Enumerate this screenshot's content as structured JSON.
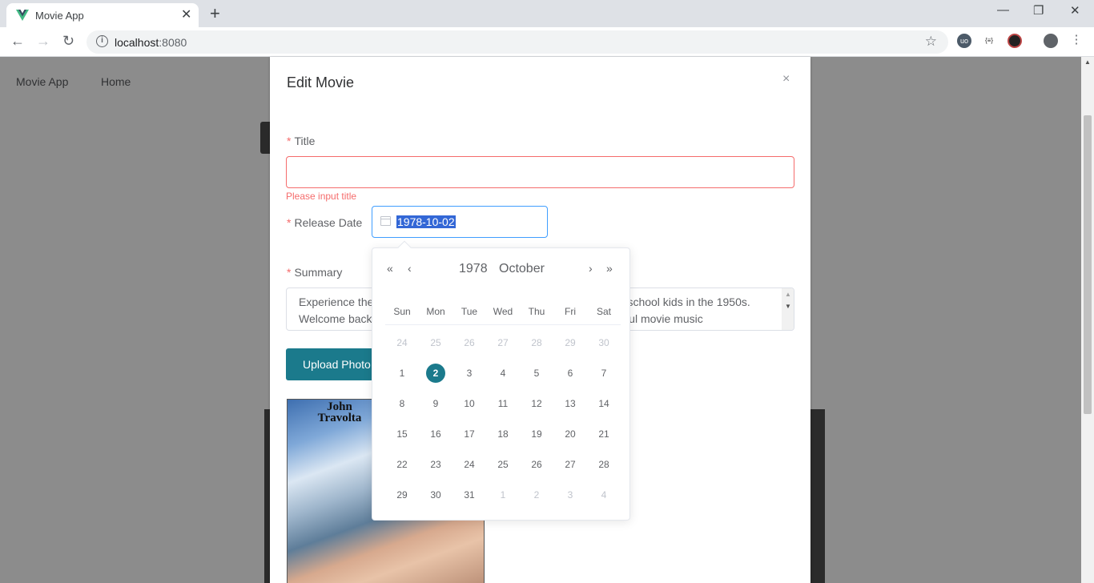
{
  "browser": {
    "tab_title": "Movie App",
    "url_host": "localhost",
    "url_port": ":8080",
    "tab_close": "✕",
    "new_tab": "+",
    "minimize": "—",
    "restore": "❐",
    "close": "✕",
    "back": "←",
    "forward": "→",
    "reload": "↻",
    "star": "☆",
    "accent": "#1b7a8c"
  },
  "nav": {
    "brand": "Movie App",
    "home": "Home"
  },
  "dialog": {
    "title": "Edit Movie",
    "close": "×",
    "title_label": "Title",
    "title_value": "",
    "title_error": "Please input title",
    "release_label": "Release Date",
    "release_value": "1978-10-02",
    "summary_label": "Summary",
    "summary_text": "Experience the fun and frolic of Rydell High School's class of high school kids in the 1950s. Welcome back to the musical phenomenon with the most successful movie music",
    "required_mark": "*",
    "upload_button": "Upload Photo",
    "poster_text": "John Travolta"
  },
  "datepicker": {
    "year": "1978",
    "month": "October",
    "prev_year": "«",
    "prev_month": "‹",
    "next_month": "›",
    "next_year": "»",
    "weekdays": [
      "Sun",
      "Mon",
      "Tue",
      "Wed",
      "Thu",
      "Fri",
      "Sat"
    ],
    "weeks": [
      [
        "24",
        "25",
        "26",
        "27",
        "28",
        "29",
        "30"
      ],
      [
        "1",
        "2",
        "3",
        "4",
        "5",
        "6",
        "7"
      ],
      [
        "8",
        "9",
        "10",
        "11",
        "12",
        "13",
        "14"
      ],
      [
        "15",
        "16",
        "17",
        "18",
        "19",
        "20",
        "21"
      ],
      [
        "22",
        "23",
        "24",
        "25",
        "26",
        "27",
        "28"
      ],
      [
        "29",
        "30",
        "31",
        "1",
        "2",
        "3",
        "4"
      ]
    ],
    "selected": "2"
  }
}
